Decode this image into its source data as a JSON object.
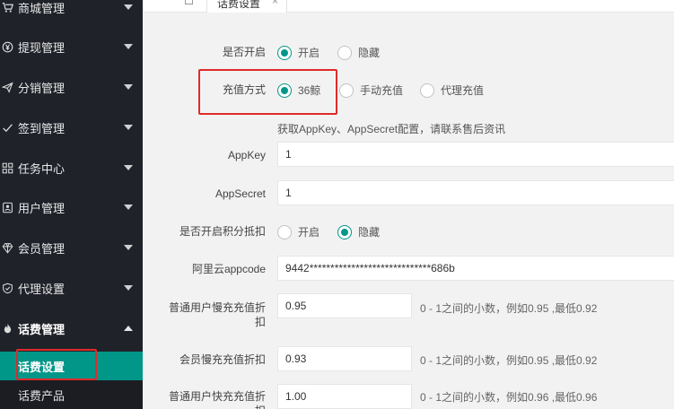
{
  "sidebar": {
    "items": [
      {
        "label": "商城管理",
        "icon": "cart-icon"
      },
      {
        "label": "提现管理",
        "icon": "yen-icon"
      },
      {
        "label": "分销管理",
        "icon": "send-icon"
      },
      {
        "label": "签到管理",
        "icon": "check-icon"
      },
      {
        "label": "任务中心",
        "icon": "grid-icon"
      },
      {
        "label": "用户管理",
        "icon": "user-icon"
      },
      {
        "label": "会员管理",
        "icon": "diamond-icon"
      },
      {
        "label": "代理设置",
        "icon": "shield-icon"
      },
      {
        "label": "话费管理",
        "icon": "flame-icon"
      }
    ],
    "sub_items": [
      {
        "label": "话费设置",
        "active": true
      },
      {
        "label": "话费产品",
        "active": false
      }
    ]
  },
  "tabbar": {
    "tab_label": "话费设置",
    "close_glyph": "×"
  },
  "form": {
    "enable": {
      "label": "是否开启",
      "options": [
        "开启",
        "隐藏"
      ],
      "selected": "开启"
    },
    "recharge_mode": {
      "label": "充值方式",
      "options": [
        "36鲸",
        "手动充值",
        "代理充值"
      ],
      "selected": "36鲸"
    },
    "note": "获取AppKey、AppSecret配置，请联系售后资讯",
    "appkey": {
      "label": "AppKey",
      "value": "1"
    },
    "appsecret": {
      "label": "AppSecret",
      "value": "1"
    },
    "points_deduct": {
      "label": "是否开启积分抵扣",
      "options": [
        "开启",
        "隐藏"
      ],
      "selected": "隐藏"
    },
    "aliyun_appcode": {
      "label": "阿里云appcode",
      "value": "9442*****************************686b"
    },
    "normal_slow": {
      "label": "普通用户慢充充值折扣",
      "value": "0.95",
      "hint": "0 - 1之间的小数，例如0.95 ,最低0.92"
    },
    "member_slow": {
      "label": "会员慢充充值折扣",
      "value": "0.93",
      "hint": "0 - 1之间的小数，例如0.95 ,最低0.92"
    },
    "normal_fast": {
      "label": "普通用户快充充值折扣",
      "value": "1.00",
      "hint": "0 - 1之间的小数，例如0.96 ,最低0.96"
    }
  },
  "colors": {
    "accent": "#009688",
    "sidebar_bg": "#20222a",
    "highlight": "#e02a2a"
  }
}
